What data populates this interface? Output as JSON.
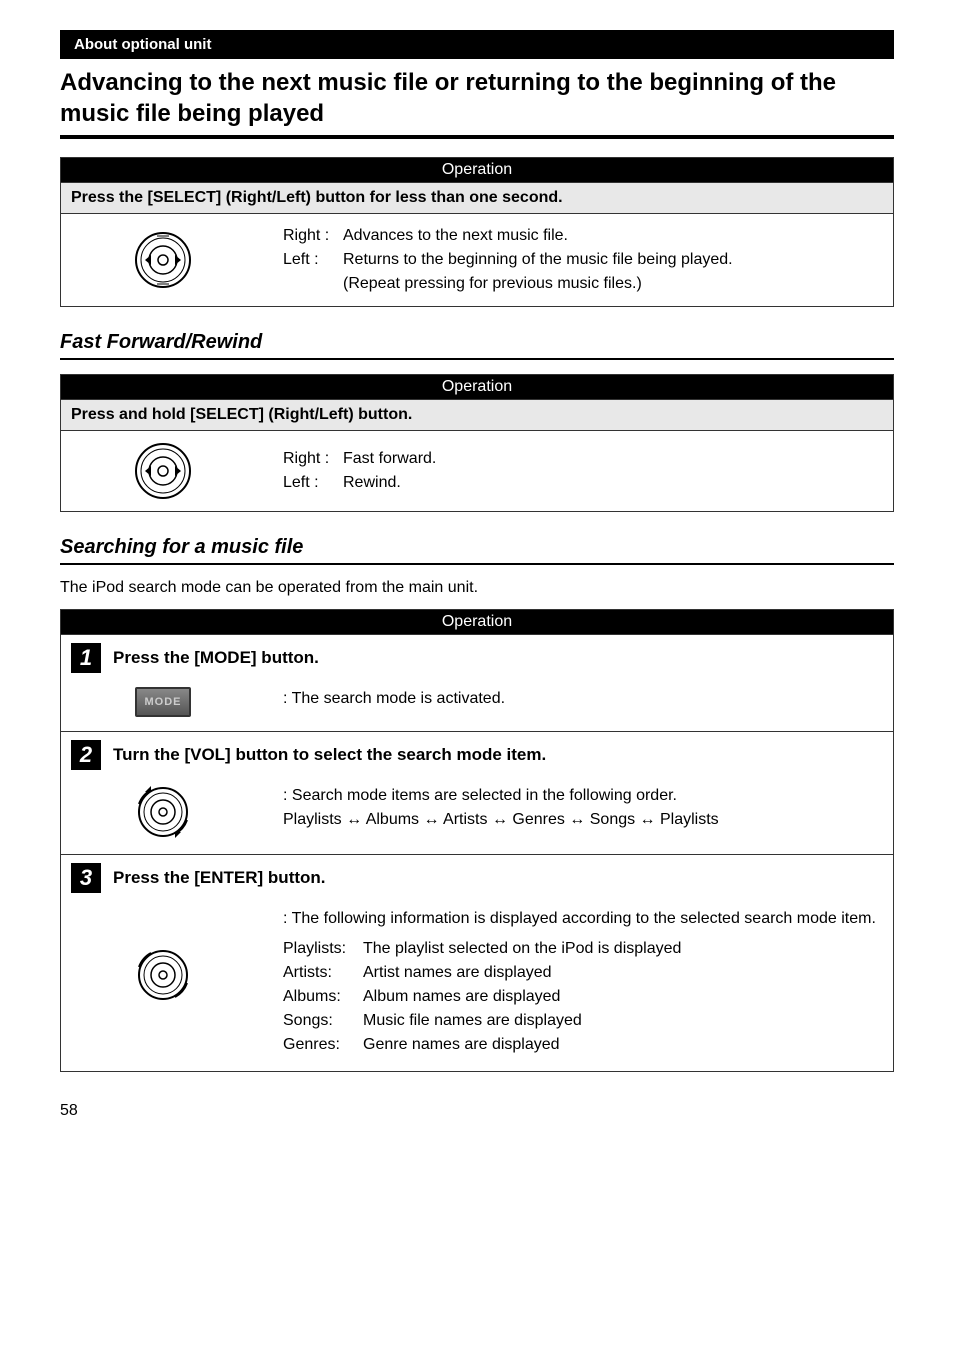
{
  "header_tab": "About optional unit",
  "main_title": "Advancing to the next music file or returning to the beginning of the music file being played",
  "sections": [
    {
      "op_header": "Operation",
      "subheader": "Press the [SELECT] (Right/Left) button for less than one second.",
      "lines": {
        "right_label": "Right :",
        "right_text": "Advances to the next music file.",
        "left_label": "Left :",
        "left_text1": "Returns to the beginning of the music file being played.",
        "left_text2": "(Repeat pressing for previous music files.)"
      }
    }
  ],
  "fast_forward": {
    "title": "Fast Forward/Rewind",
    "op_header": "Operation",
    "subheader": "Press and hold [SELECT] (Right/Left) button.",
    "lines": {
      "right_label": "Right :",
      "right_text": "Fast forward.",
      "left_label": "Left :",
      "left_text": "Rewind."
    }
  },
  "search": {
    "title": "Searching for a music file",
    "intro": "The iPod search mode can be operated from the main unit.",
    "op_header": "Operation",
    "steps": [
      {
        "num": "1",
        "title": "Press the [MODE] button.",
        "desc": ": The search mode is activated."
      },
      {
        "num": "2",
        "title": "Turn the [VOL] button to select the search mode item.",
        "desc_line1": ": Search mode items are selected in the following order.",
        "desc_line2": "Playlists ↔ Albums ↔ Artists ↔ Genres ↔ Songs ↔ Playlists"
      },
      {
        "num": "3",
        "title": "Press the [ENTER] button.",
        "intro": ": The following information is displayed according to the selected search mode item.",
        "rows": [
          {
            "label": "Playlists:",
            "text": "The playlist selected on the iPod is displayed"
          },
          {
            "label": "Artists:",
            "text": "Artist names are displayed"
          },
          {
            "label": "Albums:",
            "text": "Album names are displayed"
          },
          {
            "label": "Songs:",
            "text": "Music file names are displayed"
          },
          {
            "label": "Genres:",
            "text": "Genre names are displayed"
          }
        ]
      }
    ]
  },
  "mode_button_label": "MODE",
  "page_number": "58"
}
